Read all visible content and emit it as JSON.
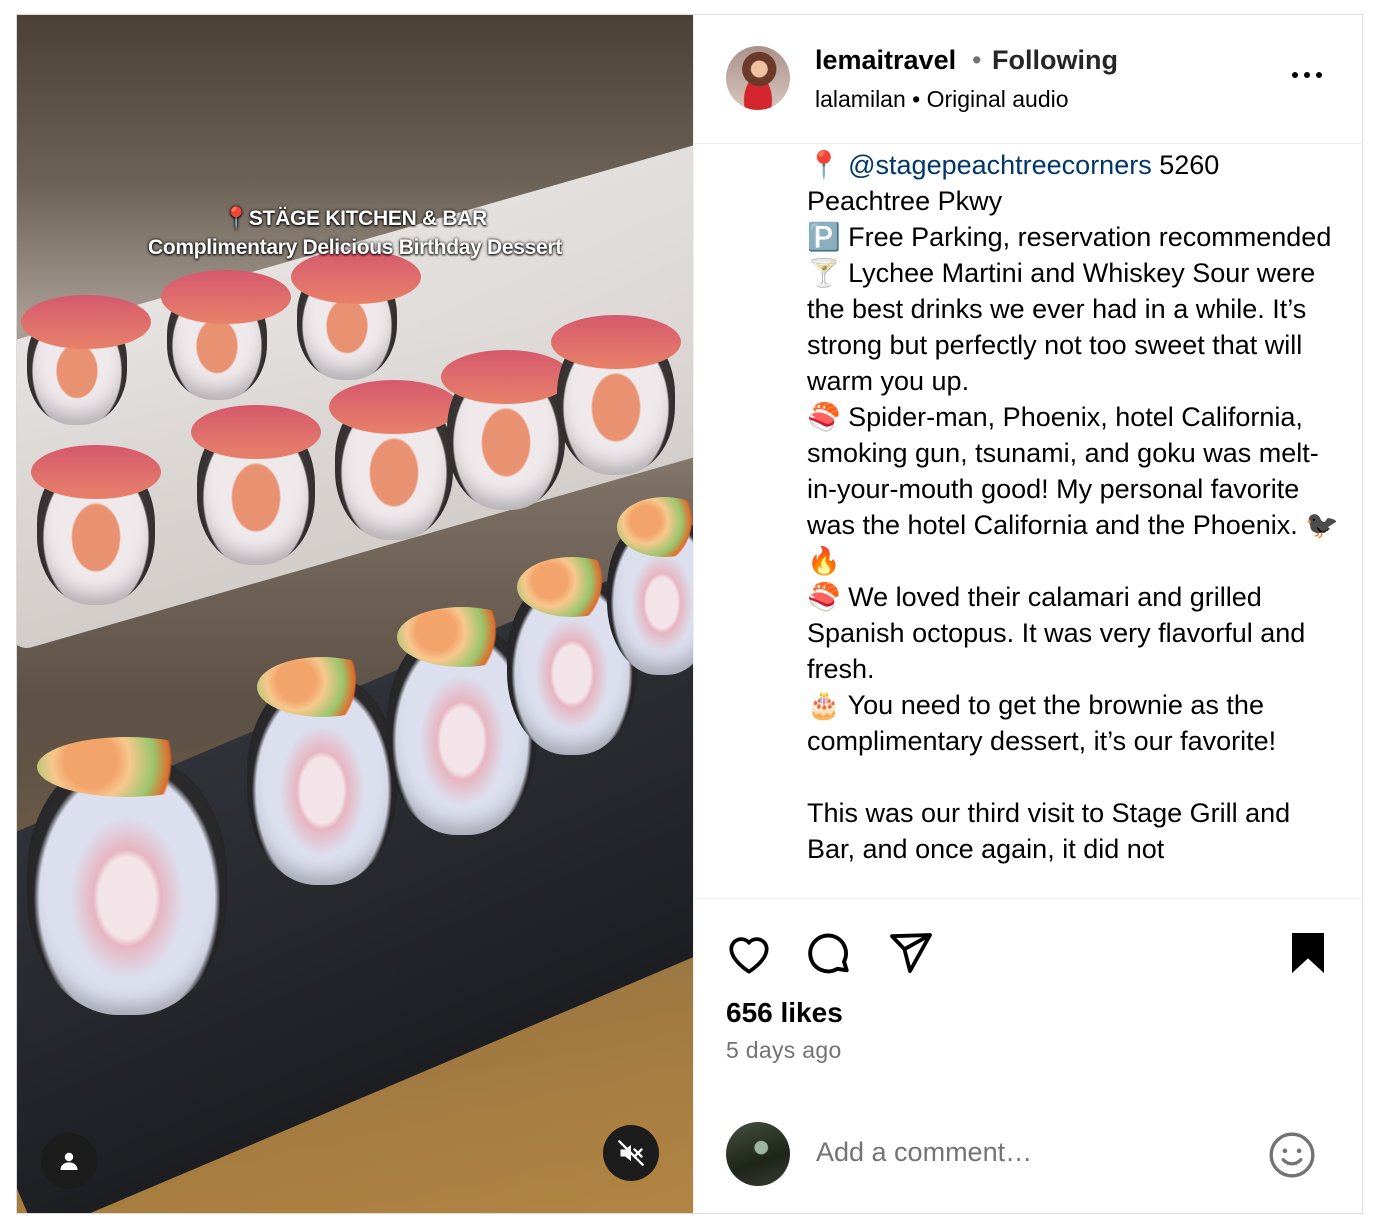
{
  "media": {
    "overlay_line1": "📍STÄGE KITCHEN & BAR",
    "overlay_line2": "Complimentary Delicious Birthday Dessert",
    "tag_icon": "person-icon",
    "mute_icon": "speaker-muted-icon"
  },
  "header": {
    "username": "lemaitravel",
    "separator": "•",
    "follow_status": "Following",
    "audio_line": "lalamilan • Original audio",
    "more_icon": "more-options-icon"
  },
  "caption": {
    "line1_pin": "📍 ",
    "mention": "@stagepeachtreecorners",
    "line1_rest": " 5260 Peachtree Pkwy",
    "line2": "🅿️ Free Parking, reservation recommended",
    "line3": "🍸 Lychee Martini and Whiskey Sour were the best drinks we ever had in a while. It’s strong but perfectly not too sweet that will warm you up.",
    "line4": "🍣 Spider-man, Phoenix, hotel California, smoking gun, tsunami, and goku was melt-in-your-mouth good! My personal favorite was the hotel California and the Phoenix. 🐦‍⬛🔥",
    "line5": "🍣 We loved their calamari and grilled Spanish octopus. It was very flavorful and fresh.",
    "line6": "🎂 You need to get the brownie as the complimentary dessert, it’s our favorite!",
    "line7": "This was our third visit to Stage Grill and Bar, and once again, it did not"
  },
  "actions": {
    "like_icon": "heart-icon",
    "comment_icon": "comment-icon",
    "share_icon": "send-icon",
    "save_icon": "bookmark-filled-icon",
    "likes": "656 likes",
    "time_ago": "5 days ago"
  },
  "comment": {
    "placeholder": "Add a comment…",
    "emoji_icon": "emoji-icon"
  }
}
